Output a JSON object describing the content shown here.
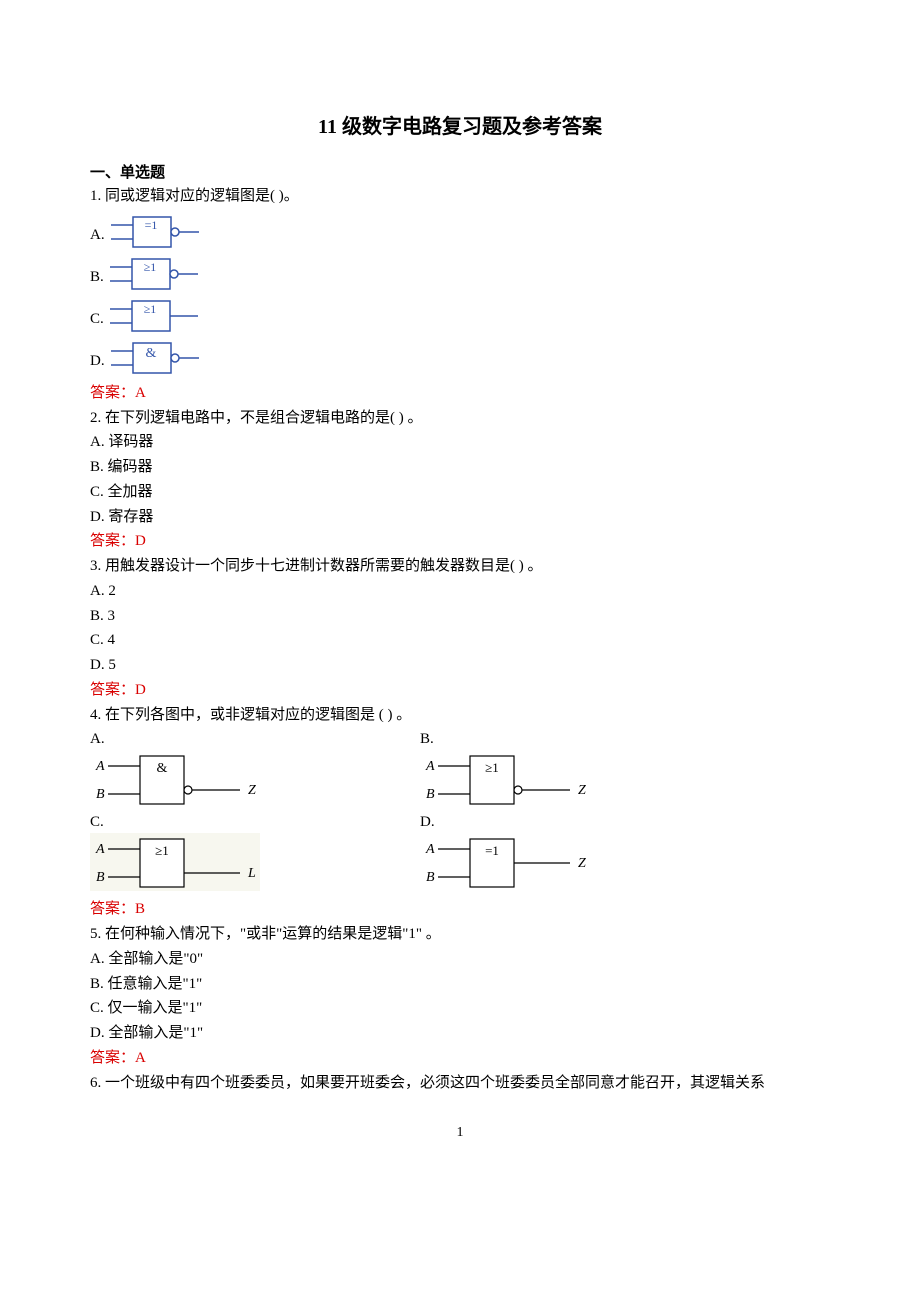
{
  "title": "11 级数字电路复习题及参考答案",
  "section1": "一、单选题",
  "q1": {
    "text": "1.  同或逻辑对应的逻辑图是(             )。",
    "opts": {
      "a": "A.",
      "b": "B.",
      "c": "C.",
      "d": "D."
    },
    "gates": {
      "a": "=1",
      "b": "≥1",
      "c": "≥1",
      "d": "&"
    },
    "answer": "答案：A"
  },
  "q2": {
    "text": "2.  在下列逻辑电路中，不是组合逻辑电路的是(           ) 。",
    "a": "A. 译码器",
    "b": "B. 编码器",
    "c": "C. 全加器",
    "d": "D. 寄存器",
    "answer": "答案：D"
  },
  "q3": {
    "text": "3.  用触发器设计一个同步十七进制计数器所需要的触发器数目是(           ) 。",
    "a": "A. 2",
    "b": "B. 3",
    "c": "C. 4",
    "d": "D. 5",
    "answer": "答案：D"
  },
  "q4": {
    "text": "4.  在下列各图中，或非逻辑对应的逻辑图是  (           )  。",
    "labels": {
      "a": "A.",
      "b": "B.",
      "c": "C.",
      "d": "D."
    },
    "gates": {
      "a": "&",
      "b": "≥1",
      "c": "≥1",
      "d": "=1"
    },
    "io": {
      "inA": "A",
      "inB": "B",
      "outZ": "Z",
      "outL": "L"
    },
    "answer": "答案：B"
  },
  "q5": {
    "text": "5.  在何种输入情况下，\"或非\"运算的结果是逻辑\"1\"                       。",
    "a": "A.    全部输入是\"0\"",
    "b": "B.    任意输入是\"1\"",
    "c": "C.    仅一输入是\"1\"",
    "d": "D.    全部输入是\"1\"",
    "answer": "答案：A"
  },
  "q6": {
    "text": "6.   一个班级中有四个班委委员，如果要开班委会，必须这四个班委委员全部同意才能召开，其逻辑关系"
  },
  "pageNum": "1"
}
